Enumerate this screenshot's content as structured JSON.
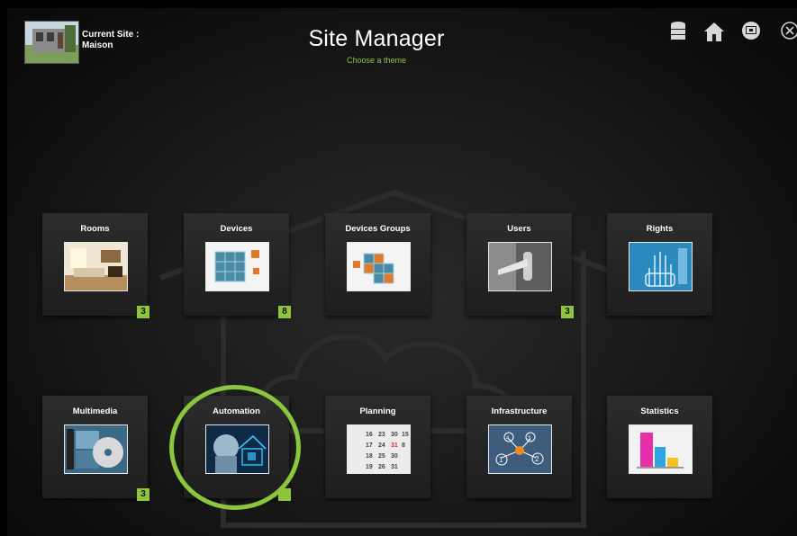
{
  "header": {
    "current_site_label": "Current Site :",
    "current_site_name": "Maison",
    "title": "Site Manager",
    "subtitle": "Choose a theme"
  },
  "toolbar": {
    "icons": [
      "database-icon",
      "home-icon",
      "display-icon",
      "close-icon"
    ]
  },
  "tiles_row1": [
    {
      "label": "Rooms",
      "badge": "3",
      "icon": "living-room-image"
    },
    {
      "label": "Devices",
      "badge": "8",
      "icon": "cubes-image"
    },
    {
      "label": "Devices Groups",
      "badge": "",
      "icon": "cube-group-image"
    },
    {
      "label": "Users",
      "badge": "3",
      "icon": "door-handle-image"
    },
    {
      "label": "Rights",
      "badge": "",
      "icon": "hand-scan-image"
    }
  ],
  "tiles_row2": [
    {
      "label": "Multimedia",
      "badge": "3",
      "icon": "media-disc-image"
    },
    {
      "label": "Automation",
      "badge": "",
      "icon": "robot-house-image"
    },
    {
      "label": "Planning",
      "badge": "",
      "icon": "calendar-image"
    },
    {
      "label": "Infrastructure",
      "badge": "",
      "icon": "network-nodes-image"
    },
    {
      "label": "Statistics",
      "badge": "",
      "icon": "bar-chart-image"
    }
  ],
  "calendar_numbers": [
    "16",
    "23",
    "30",
    "15",
    "17",
    "24",
    "31",
    "8",
    "18",
    "25",
    "30",
    "19",
    "26",
    "31"
  ],
  "infrastructure_nodes": [
    "1",
    "2",
    "3",
    "4"
  ],
  "colors": {
    "accent": "#8cc63f",
    "background": "#0a0a0a",
    "tile": "#262626"
  }
}
